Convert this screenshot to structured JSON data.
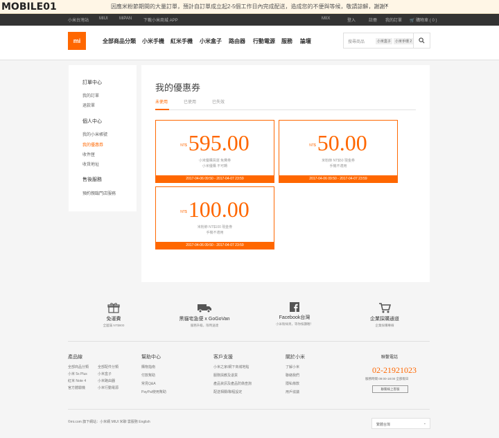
{
  "notice": {
    "logo": "MOBILE01",
    "message": "因應米粉節期間的大量訂單，預計自訂單成立起2-5個工作日內完成配送，造成您的不便與等候，敬請諒解，謝謝！",
    "close": "×"
  },
  "topbar": {
    "left": [
      "小米台灣站",
      "MIUI",
      "MiPAN",
      "下載小米商城 APP"
    ],
    "right": [
      "MIIX",
      "登入",
      "註冊",
      "我的訂單",
      "購物車 ( 0 )"
    ]
  },
  "header": {
    "logo": "mi",
    "nav": [
      "全部商品分類",
      "小米手機",
      "紅米手機",
      "小米盒子",
      "路由器",
      "行動電源",
      "服務",
      "論壇"
    ],
    "search": {
      "placeholder": "搜尋商品",
      "chips": [
        "小米盒子",
        "小米手環 2"
      ]
    }
  },
  "sidebar": {
    "sections": [
      {
        "title": "訂單中心",
        "items": [
          "我的訂單",
          "退款單"
        ]
      },
      {
        "title": "個人中心",
        "items": [
          "我的小米帳號",
          "我的優惠券",
          "收件匣",
          "收貨地址"
        ]
      },
      {
        "title": "售後服務",
        "items": [
          "預約親臨門店服務"
        ]
      }
    ],
    "active": "我的優惠券"
  },
  "main": {
    "title": "我的優惠券",
    "tabs": [
      "未使用",
      "已使用",
      "已失效"
    ],
    "active_tab": "未使用",
    "coupons": [
      {
        "currency": "NT$",
        "amount": "595.00",
        "line1": "小米優購買運 免費券",
        "line2": "小米優購 不可轉",
        "validity": "2017-04-06 09:50 - 2017-04-07 23:59"
      },
      {
        "currency": "NT$",
        "amount": "50.00",
        "line1": "米粉節 NT$50 現金券",
        "line2": "手機不適用",
        "validity": "2017-04-06 09:50 - 2017-04-07 23:59"
      },
      {
        "currency": "NT$",
        "amount": "100.00",
        "line1": "米粉節 NT$100 現金券",
        "line2": "手機不適用",
        "validity": "2017-04-06 09:50 - 2017-04-07 23:59"
      }
    ]
  },
  "footer": {
    "services": [
      {
        "title": "免運費",
        "sub": "全國滿 NT$800"
      },
      {
        "title": "黑貓宅急便 x GoGoVan",
        "sub": "服務升級，限時送達"
      },
      {
        "title": "Facebook台灣",
        "sub": "小米粉絲頁，等你按讚喔！"
      },
      {
        "title": "企業採購通道",
        "sub": "企業採購專線"
      }
    ],
    "columns": [
      {
        "title": "產品線",
        "items": [
          "全部商品分類",
          "小米 5s Plus",
          "紅米 Note 4",
          "官方體驗機",
          "全部配件分類",
          "小米盒子",
          "小米路由器",
          "小米行動電源"
        ]
      },
      {
        "title": "幫助中心",
        "items": [
          "購物指南",
          "付款幫助",
          "常見Q&A",
          "PayPal使用幫助"
        ]
      },
      {
        "title": "客戶支援",
        "items": [
          "小米之家/網下商城地點",
          "服務與教及退貨",
          "產品資訊及產品防偽查詢",
          "配送相關/聯程設定"
        ]
      },
      {
        "title": "關於小米",
        "items": [
          "了解小米",
          "聯絡我們",
          "隱私條款",
          "用戶協議"
        ]
      }
    ],
    "hotline": {
      "title": "聯繫電話",
      "number": "02-21921023",
      "hours": "服務時間 09:00-18:00 全部假日",
      "button": "聯繫線上客服"
    },
    "copyright": "©mi.com 旗下網站：小米網 MIUI 米聊 雲服務 English",
    "region": "繁體台灣"
  },
  "colors": {
    "accent": "#ff6700",
    "topbar": "#333333"
  }
}
